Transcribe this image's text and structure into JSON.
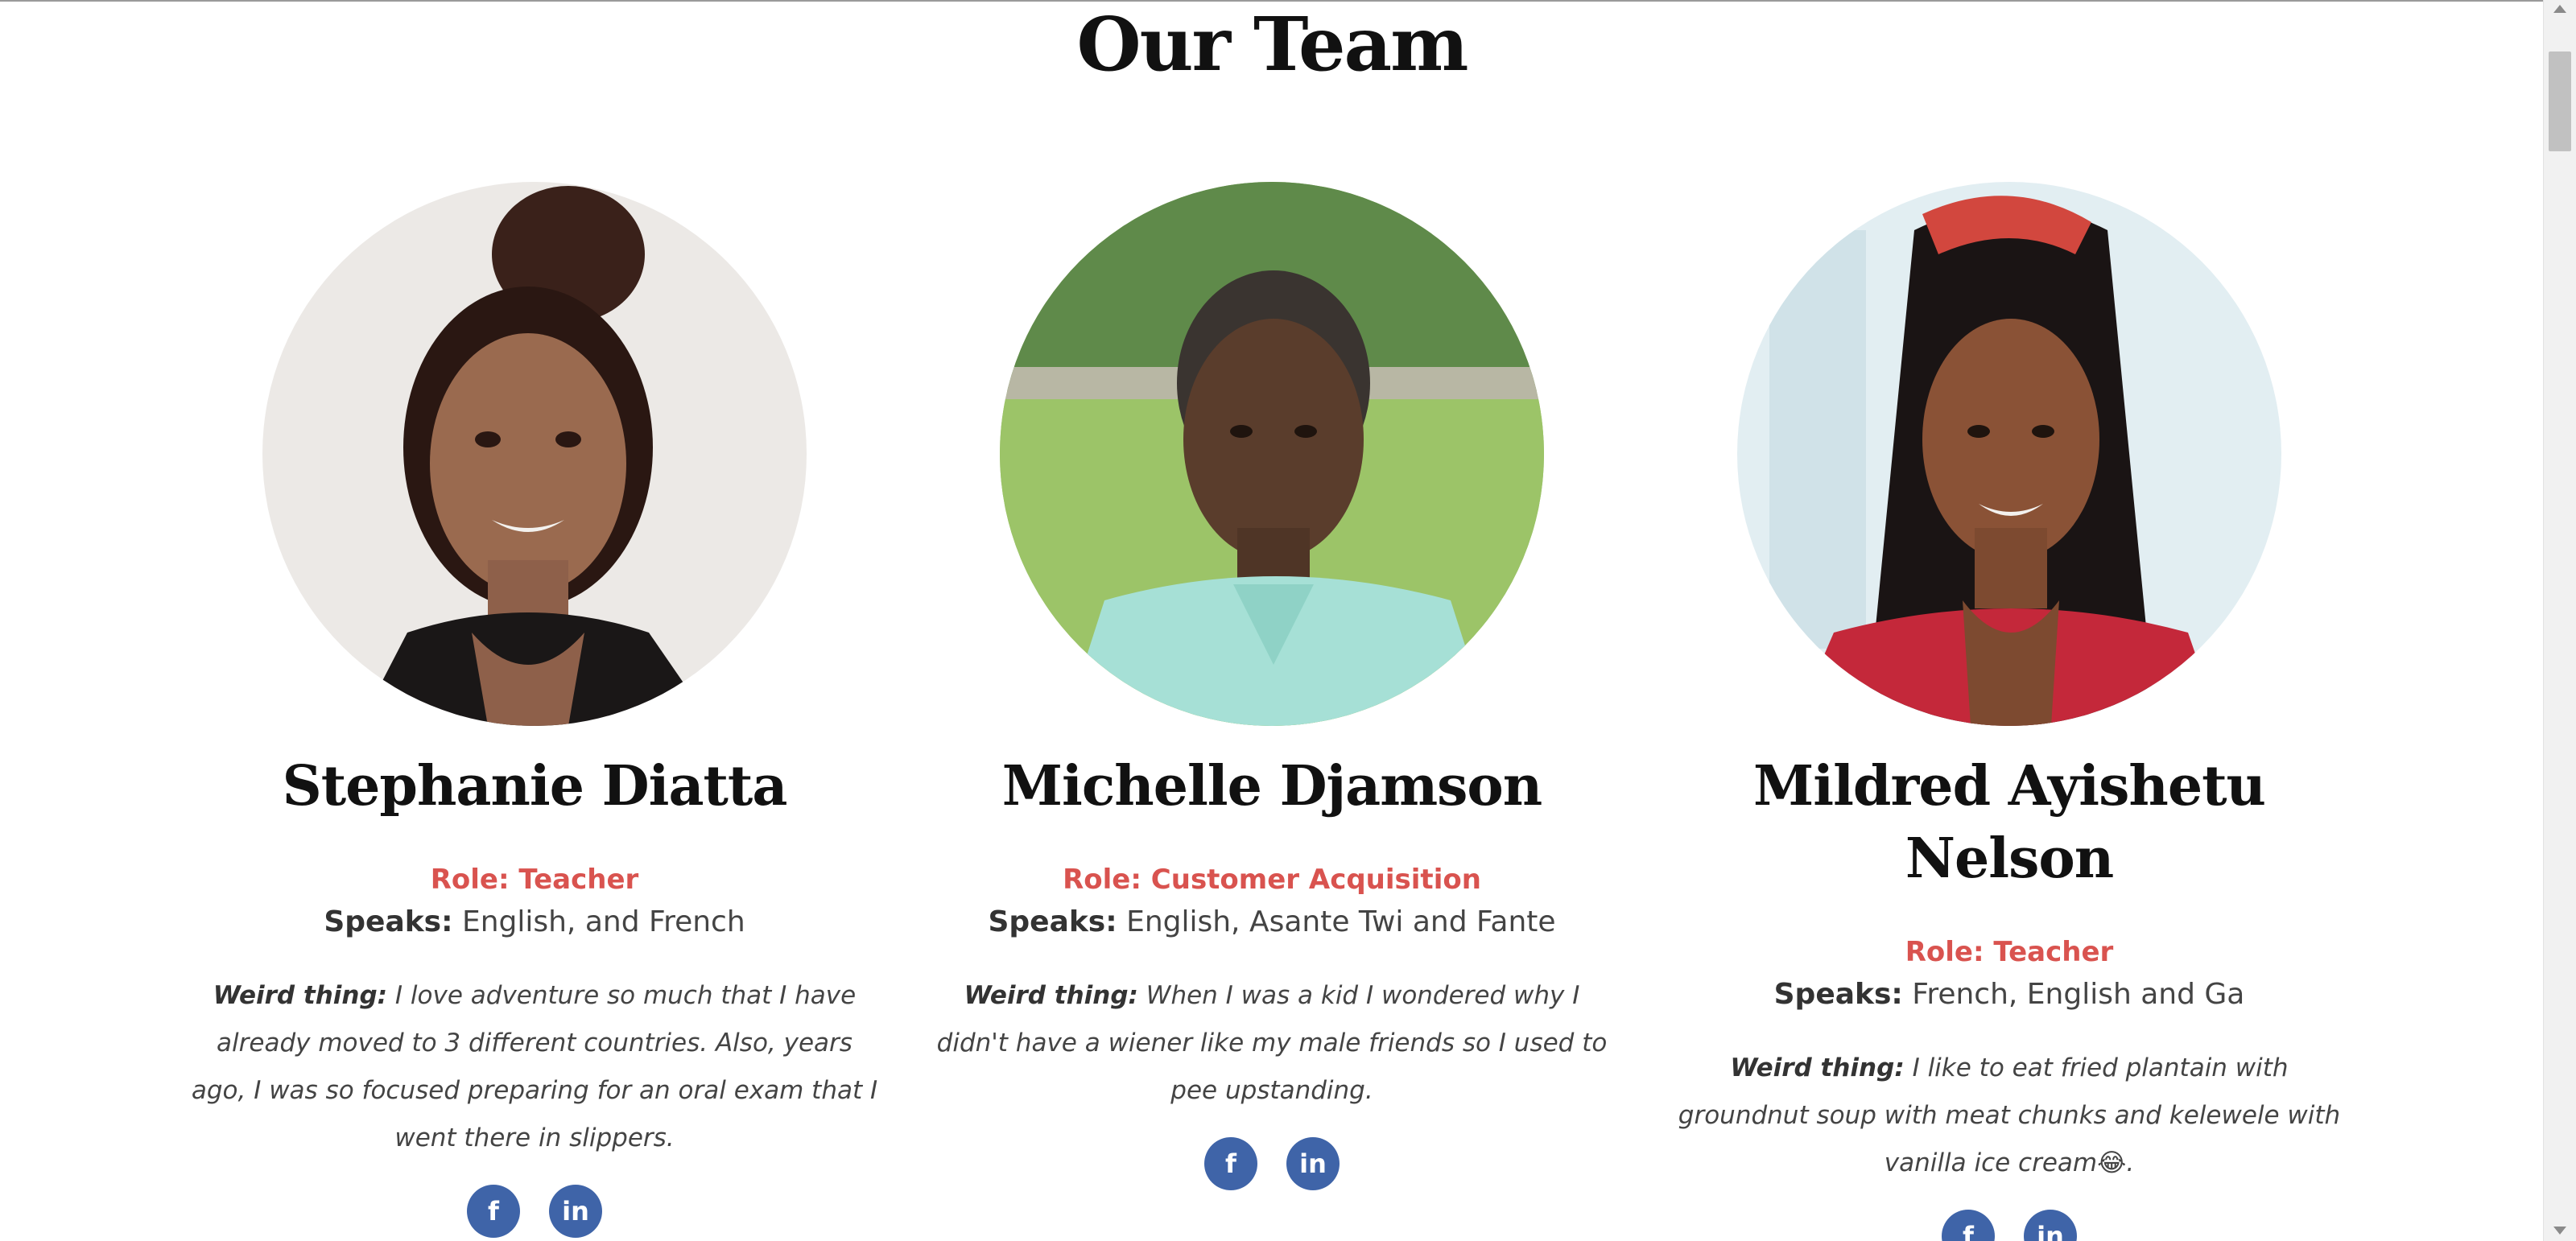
{
  "section": {
    "heading": "Our Team"
  },
  "members": [
    {
      "name": "Stephanie Diatta",
      "role": "Role: Teacher",
      "speaks_label": "Speaks:",
      "speaks_value": " English, and French",
      "weird_label": "Weird thing:",
      "weird_value": " I love adventure so much that I have already moved to 3 different countries. Also, years ago, I was so focused preparing for an oral exam that I went there in slippers."
    },
    {
      "name": "Michelle Djamson",
      "role": "Role: Customer Acquisition",
      "speaks_label": "Speaks:",
      "speaks_value": " English, Asante Twi and Fante",
      "weird_label": "Weird thing:",
      "weird_value": " When I was a kid I wondered why I didn't have a wiener like my male friends so I used to pee upstanding."
    },
    {
      "name": "Mildred Ayishetu Nelson",
      "role": "Role: Teacher",
      "speaks_label": "Speaks:",
      "speaks_value": " French, English and Ga",
      "weird_label": "Weird thing:",
      "weird_value": " I like to eat fried plantain with groundnut soup with meat chunks and kelewele with vanilla ice cream😂."
    }
  ],
  "social": {
    "facebook_glyph": "f",
    "linkedin_glyph": "in"
  },
  "colors": {
    "role": "#d9534f",
    "social_button": "#3f64a8",
    "heading": "#111111"
  }
}
